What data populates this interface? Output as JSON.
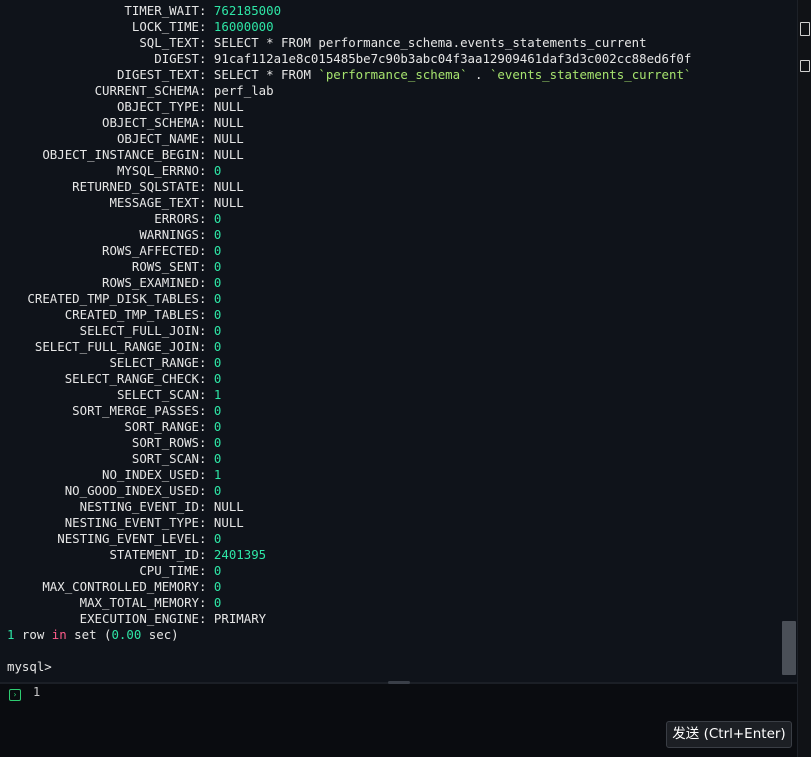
{
  "terminal": {
    "rows": [
      {
        "key": "TIMER_WAIT",
        "value": "762185000",
        "kind": "num"
      },
      {
        "key": "LOCK_TIME",
        "value": "16000000",
        "kind": "num"
      },
      {
        "key": "SQL_TEXT",
        "value": "SELECT * FROM performance_schema.events_statements_current",
        "kind": "text"
      },
      {
        "key": "DIGEST",
        "value": "91caf112a1e8c015485be7c90b3abc04f3aa12909461daf3d3c002cc88ed6f0f",
        "kind": "text"
      },
      {
        "key": "DIGEST_TEXT",
        "value_prefix": "SELECT * FROM ",
        "value_q1": "`performance_schema`",
        "value_mid": " . ",
        "value_q2": "`events_statements_current`",
        "kind": "digest"
      },
      {
        "key": "CURRENT_SCHEMA",
        "value": "perf_lab",
        "kind": "text"
      },
      {
        "key": "OBJECT_TYPE",
        "value": "NULL",
        "kind": "text"
      },
      {
        "key": "OBJECT_SCHEMA",
        "value": "NULL",
        "kind": "text"
      },
      {
        "key": "OBJECT_NAME",
        "value": "NULL",
        "kind": "text"
      },
      {
        "key": "OBJECT_INSTANCE_BEGIN",
        "value": "NULL",
        "kind": "text"
      },
      {
        "key": "MYSQL_ERRNO",
        "value": "0",
        "kind": "num"
      },
      {
        "key": "RETURNED_SQLSTATE",
        "value": "NULL",
        "kind": "text"
      },
      {
        "key": "MESSAGE_TEXT",
        "value": "NULL",
        "kind": "text"
      },
      {
        "key": "ERRORS",
        "value": "0",
        "kind": "num"
      },
      {
        "key": "WARNINGS",
        "value": "0",
        "kind": "num"
      },
      {
        "key": "ROWS_AFFECTED",
        "value": "0",
        "kind": "num"
      },
      {
        "key": "ROWS_SENT",
        "value": "0",
        "kind": "num"
      },
      {
        "key": "ROWS_EXAMINED",
        "value": "0",
        "kind": "num"
      },
      {
        "key": "CREATED_TMP_DISK_TABLES",
        "value": "0",
        "kind": "num"
      },
      {
        "key": "CREATED_TMP_TABLES",
        "value": "0",
        "kind": "num"
      },
      {
        "key": "SELECT_FULL_JOIN",
        "value": "0",
        "kind": "num"
      },
      {
        "key": "SELECT_FULL_RANGE_JOIN",
        "value": "0",
        "kind": "num"
      },
      {
        "key": "SELECT_RANGE",
        "value": "0",
        "kind": "num"
      },
      {
        "key": "SELECT_RANGE_CHECK",
        "value": "0",
        "kind": "num"
      },
      {
        "key": "SELECT_SCAN",
        "value": "1",
        "kind": "num"
      },
      {
        "key": "SORT_MERGE_PASSES",
        "value": "0",
        "kind": "num"
      },
      {
        "key": "SORT_RANGE",
        "value": "0",
        "kind": "num"
      },
      {
        "key": "SORT_ROWS",
        "value": "0",
        "kind": "num"
      },
      {
        "key": "SORT_SCAN",
        "value": "0",
        "kind": "num"
      },
      {
        "key": "NO_INDEX_USED",
        "value": "1",
        "kind": "num"
      },
      {
        "key": "NO_GOOD_INDEX_USED",
        "value": "0",
        "kind": "num"
      },
      {
        "key": "NESTING_EVENT_ID",
        "value": "NULL",
        "kind": "text"
      },
      {
        "key": "NESTING_EVENT_TYPE",
        "value": "NULL",
        "kind": "text"
      },
      {
        "key": "NESTING_EVENT_LEVEL",
        "value": "0",
        "kind": "num"
      },
      {
        "key": "STATEMENT_ID",
        "value": "2401395",
        "kind": "num"
      },
      {
        "key": "CPU_TIME",
        "value": "0",
        "kind": "num"
      },
      {
        "key": "MAX_CONTROLLED_MEMORY",
        "value": "0",
        "kind": "num"
      },
      {
        "key": "MAX_TOTAL_MEMORY",
        "value": "0",
        "kind": "num"
      },
      {
        "key": "EXECUTION_ENGINE",
        "value": "PRIMARY",
        "kind": "text"
      }
    ],
    "summary": {
      "count": "1",
      "w_row": " row ",
      "w_in": "in",
      "w_set": " set (",
      "time": "0.00",
      "w_sec": " sec)"
    },
    "prompt": "mysql>"
  },
  "editor": {
    "line_number": "1",
    "run_icon": "terminal-run-icon"
  },
  "send_button": {
    "label": "发送 (Ctrl+Enter)"
  },
  "colors": {
    "number": "#2ee6a6",
    "keyword": "#ff5c8a",
    "string": "#a6e36e",
    "background": "#0f131a"
  }
}
